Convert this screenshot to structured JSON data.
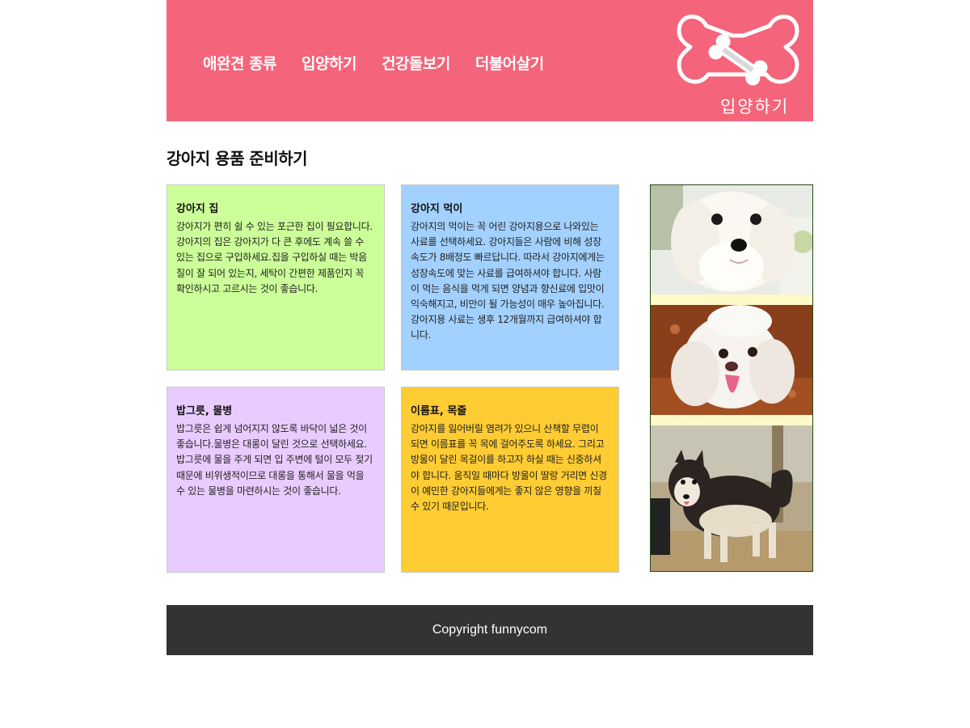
{
  "header": {
    "nav": [
      {
        "label": "애완견 종류"
      },
      {
        "label": "입양하기"
      },
      {
        "label": "건강돌보기"
      },
      {
        "label": "더불어살기"
      }
    ],
    "logo_text": "입양하기",
    "background": "#f4647a"
  },
  "main": {
    "title": "강아지 용품 준비하기",
    "cards": [
      {
        "title": "강아지 집",
        "body": "강아지가 편히 쉴 수 있는 포근한 집이 필요합니다. 강아지의 집은 강아지가 다 큰 후에도 계속 쓸 수 있는 집으로 구입하세요.집을 구입하실 때는 박음질이 잘 되어 있는지, 세탁이 간편한 제품인지 꼭 확인하시고 고르시는 것이 좋습니다.",
        "color": "#ccff99"
      },
      {
        "title": "강아지 먹이",
        "body": "강아지의 먹이는 꼭 어린 강아지용으로 나와있는 사료를 선택하세요. 강아지들은 사람에 비해 성장속도가 8배정도 빠르답니다. 따라서 강아지에게는 성장속도에 맞는 사료를 급여하셔야 합니다. 사람이 먹는 음식을 먹게 되면 양념과 향신료에 입맛이 익숙해지고, 비만이 될 가능성이 매우 높아집니다. 강아지용 사료는 생후 12개월까지 급여하셔야 합니다.",
        "color": "#a3d1ff"
      },
      {
        "title": "밥그릇, 물병",
        "body": "밥그릇은 쉽게 넘어지지 않도록 바닥이 넓은 것이 좋습니다.물병은 대롱이 달린 것으로 선택하세요. 밥그릇에 물을 주게 되면 입 주변에 털이 모두 젖기 때문에 비위생적이므로 대롱을 통해서 물을 먹을 수 있는 물병을 마련하시는 것이 좋습니다.",
        "color": "#e9ccff"
      },
      {
        "title": "이름표, 목줄",
        "body": "강아지를 잃어버릴 염려가 있으니 산책할 무렵이 되면 이름표를 꼭 목에 걸어주도록 하세요. 그리고 방울이 달린 목걸이를 하고자 하실 때는 신중하셔야 합니다. 움직일 때마다 방울이 딸랑 거리면 신경이 예민한 강아지들에게는 좋지 않은 영향을 끼칠 수 있기 때문입니다.",
        "color": "#ffcc33"
      }
    ],
    "photos": [
      {
        "subject": "white-maltese-puppy"
      },
      {
        "subject": "white-poodle-tongue-out"
      },
      {
        "subject": "alaskan-malamute"
      }
    ]
  },
  "footer": {
    "copyright": "Copyright funnycom",
    "background": "#333333"
  }
}
